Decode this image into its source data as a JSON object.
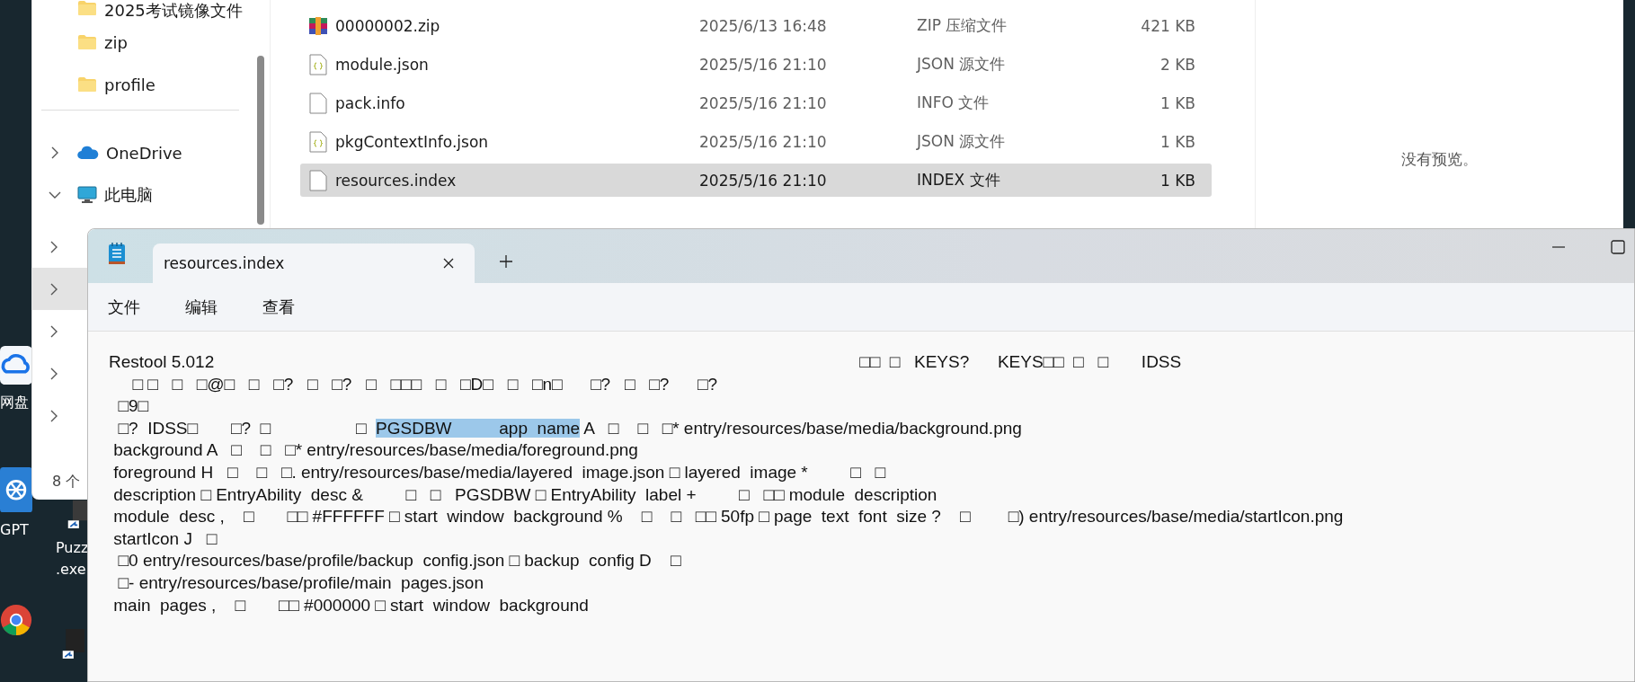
{
  "explorer": {
    "nav_items": [
      {
        "kind": "folder",
        "label": "2025考试镜像文件",
        "selected": false
      },
      {
        "kind": "folder",
        "label": "zip",
        "selected": false
      },
      {
        "kind": "folder",
        "label": "profile",
        "selected": false
      },
      {
        "kind": "separator"
      },
      {
        "kind": "onedrive",
        "label": "OneDrive",
        "expanded": false,
        "selected": false
      },
      {
        "kind": "pc",
        "label": "此电脑",
        "expanded": true,
        "selected": false
      }
    ],
    "hidden_rows": [
      {
        "selected": false
      },
      {
        "selected": true
      },
      {
        "selected": false
      },
      {
        "selected": false
      },
      {
        "selected": false
      }
    ],
    "status": "8 个",
    "files": [
      {
        "kind": "zip",
        "name": "00000002.zip",
        "date": "2025/6/13 16:48",
        "type": "ZIP 压缩文件",
        "size": "421 KB",
        "selected": false
      },
      {
        "kind": "json",
        "name": "module.json",
        "date": "2025/5/16 21:10",
        "type": "JSON 源文件",
        "size": "2 KB",
        "selected": false
      },
      {
        "kind": "file",
        "name": "pack.info",
        "date": "2025/5/16 21:10",
        "type": "INFO 文件",
        "size": "1 KB",
        "selected": false
      },
      {
        "kind": "json",
        "name": "pkgContextInfo.json",
        "date": "2025/5/16 21:10",
        "type": "JSON 源文件",
        "size": "1 KB",
        "selected": false
      },
      {
        "kind": "file",
        "name": "resources.index",
        "date": "2025/5/16 21:10",
        "type": "INDEX 文件",
        "size": "1 KB",
        "selected": true
      }
    ],
    "preview_message": "没有预览。"
  },
  "notepad": {
    "tab_title": "resources.index",
    "menu": [
      "文件",
      "编辑",
      "查看"
    ],
    "lines": [
      [
        {
          "text": "Restool 5.012                                                                                                                                        □□  □   KEYS?      KEYS□□  □   □       IDSS",
          "selected": false
        }
      ],
      [
        {
          "text": "     □ □   □   □@□   □   □?   □   □?   □   □□□   □   □D□   □   □n□      □?   □   □?      □?",
          "selected": false
        }
      ],
      [
        {
          "text": "  □9□",
          "selected": false
        }
      ],
      [
        {
          "text": "  □?  IDSS□       □?  □                  □  ",
          "selected": false
        },
        {
          "text": "PGSDBW          app  name",
          "selected": true
        },
        {
          "text": " A   □    □   □* entry/resources/base/media/background.png",
          "selected": false
        }
      ],
      [
        {
          "text": " background A   □    □   □* entry/resources/base/media/foreground.png",
          "selected": false
        }
      ],
      [
        {
          "text": " foreground H   □    □   □. entry/resources/base/media/layered  image.json □ layered  image *         □   □",
          "selected": false
        }
      ],
      [
        {
          "text": " description □ EntryAbility  desc &         □   □   PGSDBW □ EntryAbility  label +         □   □□ module  description",
          "selected": false
        }
      ],
      [
        {
          "text": " module  desc ,    □       □□ #FFFFFF □ start  window  background %    □    □   □□ 50fp □ page  text  font  size ?    □        □) entry/resources/base/media/startIcon.png",
          "selected": false
        }
      ],
      [
        {
          "text": " startIcon J   □",
          "selected": false
        }
      ],
      [
        {
          "text": "  □0 entry/resources/base/profile/backup  config.json □ backup  config D    □",
          "selected": false
        }
      ],
      [
        {
          "text": "  □- entry/resources/base/profile/main  pages.json",
          "selected": false
        }
      ],
      [
        {
          "text": " main  pages ,    □       □□ #000000 □ start  window  background",
          "selected": false
        }
      ]
    ]
  },
  "desktop_icons": [
    {
      "kind": "cloud",
      "label": "网盘"
    },
    {
      "kind": "knot",
      "label": "GPT"
    },
    {
      "kind": "exe",
      "label": "Puzz\n.exe"
    },
    {
      "kind": "chrome"
    },
    {
      "kind": "shortcut"
    }
  ]
}
